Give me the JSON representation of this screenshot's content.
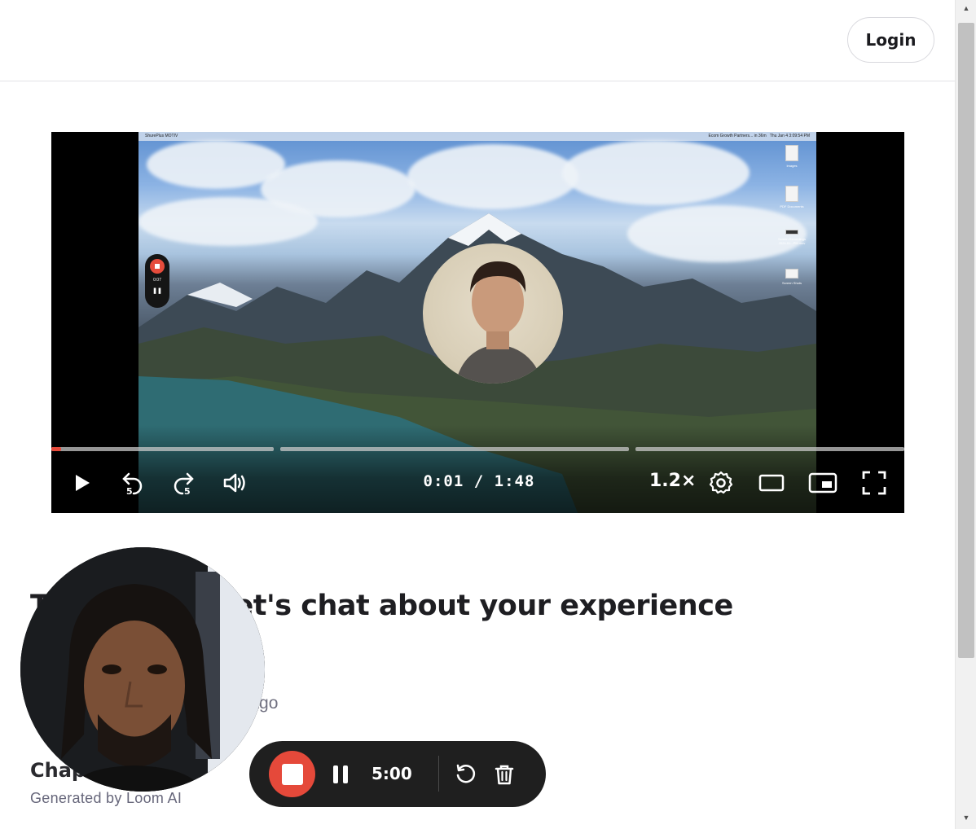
{
  "header": {
    "login_label": "Login"
  },
  "video": {
    "current_time": "0:01",
    "separator": "/",
    "duration": "1:48",
    "speed": "1.2×",
    "rewind_seconds": "5",
    "forward_seconds": "5",
    "progress_fraction": 0.01,
    "embedded_recorder_time": "0:07",
    "screen_menubar_app": "ShurePlus MOTIV",
    "screen_menubar_status": "Ecom Growth Partners... in 36m",
    "screen_menubar_clock": "Thu Jan 4  3:09:54 PM",
    "desktop_icons": [
      "Images",
      "PDF Documents",
      "Screen Recordings 2024-01...PM.mov",
      "Screen Shots"
    ]
  },
  "content": {
    "title": "T            applying! Let's chat about your experience",
    "meta": "s ago",
    "chapters_heading": "Chap",
    "generated_by": "Generated by Loom AI"
  },
  "recorder": {
    "time": "5:00"
  },
  "colors": {
    "accent_red": "#e5493a",
    "toolbar_bg": "#1f1f1f",
    "text_dark": "#1e1e22",
    "text_muted": "#707080"
  },
  "icons": [
    "play-icon",
    "rewind-5-icon",
    "forward-5-icon",
    "volume-icon",
    "settings-gear-icon",
    "theater-mode-icon",
    "picture-in-picture-icon",
    "fullscreen-icon",
    "stop-icon",
    "pause-icon",
    "restart-icon",
    "trash-icon"
  ]
}
